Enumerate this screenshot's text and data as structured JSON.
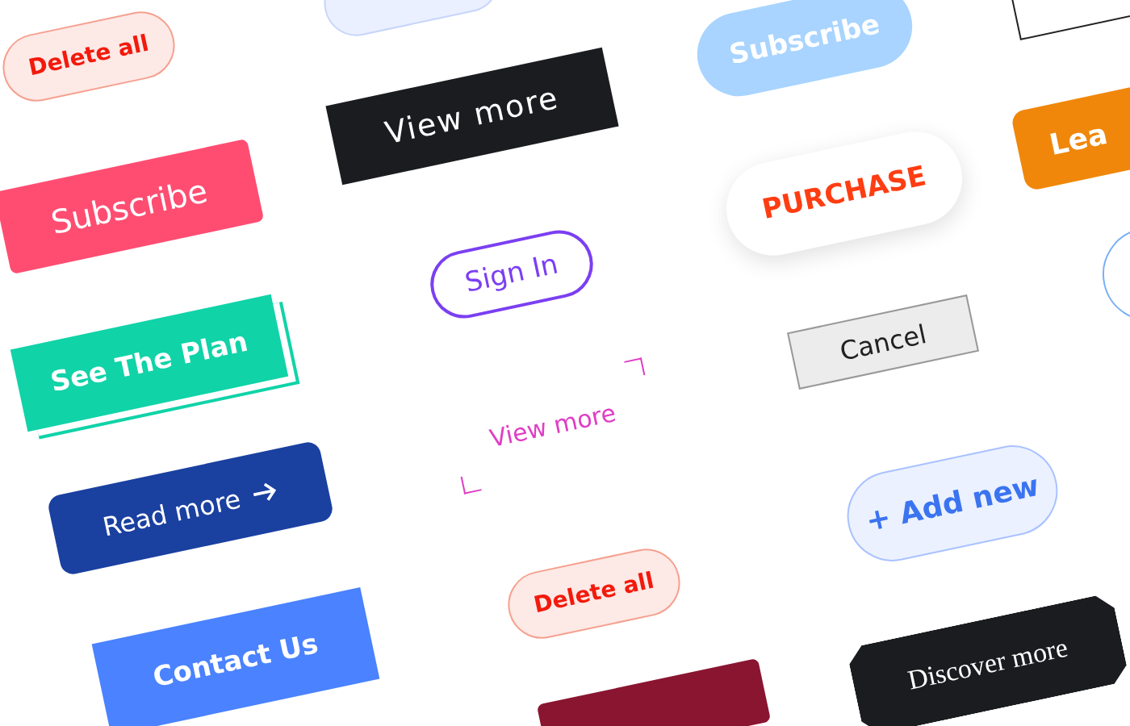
{
  "buttons": [
    {
      "kind": "soft-pill",
      "label": "Delete all"
    },
    {
      "kind": "pink",
      "label": "Subscribe"
    },
    {
      "kind": "teal-offset",
      "label": "See The Plan"
    },
    {
      "kind": "navy-arrow",
      "label": "Read more"
    },
    {
      "kind": "blue",
      "label": "Contact Us"
    },
    {
      "kind": "cut-pill"
    },
    {
      "kind": "black",
      "label": "View more"
    },
    {
      "kind": "purple-outline",
      "label": "Sign In"
    },
    {
      "kind": "bracket",
      "label": "View more"
    },
    {
      "kind": "soft-pill",
      "label": "Delete all"
    },
    {
      "kind": "maroon"
    },
    {
      "kind": "sky-pill",
      "label": "Subscribe"
    },
    {
      "kind": "shadow-pill",
      "label": "PURCHASE"
    },
    {
      "kind": "gray",
      "label": "Cancel"
    },
    {
      "kind": "outline-pill",
      "label": "+ Add new"
    },
    {
      "kind": "clipped",
      "label": "Discover more"
    },
    {
      "kind": "dotted"
    },
    {
      "kind": "orange",
      "label": "Lea"
    },
    {
      "kind": "circle"
    }
  ]
}
